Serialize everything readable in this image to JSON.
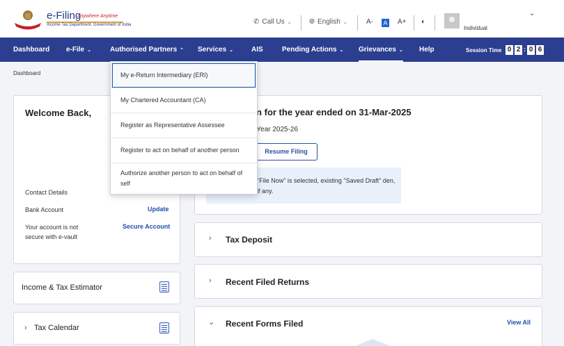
{
  "header": {
    "logo_title": "e-Filing",
    "logo_tagline": "Anywhere Anytime",
    "logo_subtitle": "Income Tax Department, Government of India",
    "call_us": "Call Us",
    "language": "English",
    "font_decrease": "A-",
    "font_normal": "A",
    "font_increase": "A+",
    "username": "Individual"
  },
  "nav": {
    "items": [
      {
        "label": "Dashboard"
      },
      {
        "label": "e-File"
      },
      {
        "label": "Authorised Partners"
      },
      {
        "label": "Services"
      },
      {
        "label": "AIS"
      },
      {
        "label": "Pending Actions"
      },
      {
        "label": "Grievances"
      },
      {
        "label": "Help"
      }
    ],
    "session_label": "Session Time",
    "session_digits": [
      "0",
      "2",
      "0",
      "6"
    ]
  },
  "breadcrumb": "Dashboard",
  "profile": {
    "welcome": "Welcome Back,",
    "contact_label": "Contact Details",
    "bank_label": "Bank Account",
    "bank_action": "Update",
    "vault_label": "Your account is not secure with e-vault",
    "vault_action": "Secure Account"
  },
  "sidebar": {
    "estimator": "Income & Tax Estimator",
    "calendar": "Tax Calendar"
  },
  "filing": {
    "title": "rn for the year ended on 31-Mar-2025",
    "subtitle": "t Year 2025-26",
    "resume_button": "Resume Filing",
    "info": "\"File Now\" is selected, existing \"Saved Draft\" den, if any."
  },
  "accordions": {
    "tax_deposit": "Tax Deposit",
    "recent_returns": "Recent Filed Returns",
    "recent_forms": "Recent Forms Filed",
    "view_all": "View All"
  },
  "dropdown": {
    "items": [
      {
        "label": "My e-Return Intermediary (ERI)"
      },
      {
        "label": "My Chartered Accountant (CA)"
      },
      {
        "label": "Register as Representative Assessee"
      },
      {
        "label": "Register to act on behalf of another person"
      },
      {
        "label": "Authorize another person to act on behalf of self"
      }
    ]
  },
  "colors": {
    "nav_bg": "#2b3e8f",
    "link": "#1e50a8",
    "info_bg": "#e8f0fb"
  }
}
